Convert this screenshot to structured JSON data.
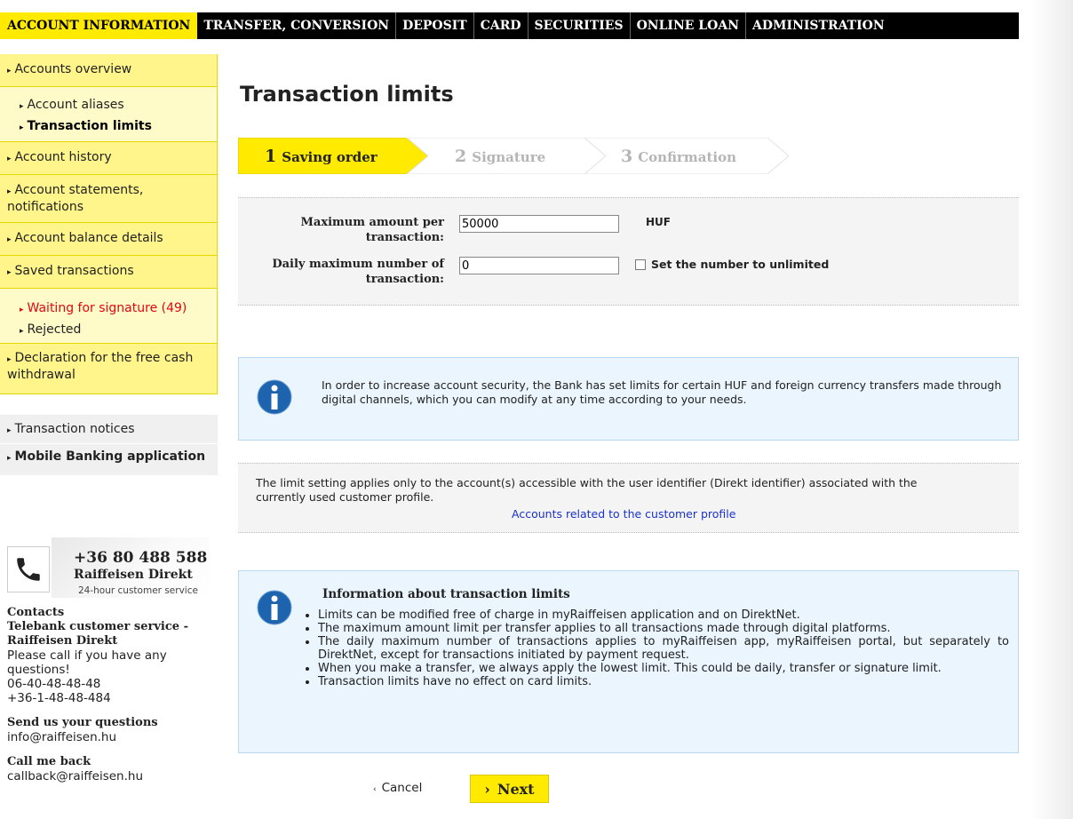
{
  "topnav": {
    "tabs": [
      {
        "label": "ACCOUNT INFORMATION"
      },
      {
        "label": "TRANSFER, CONVERSION"
      },
      {
        "label": "DEPOSIT"
      },
      {
        "label": "CARD"
      },
      {
        "label": "SECURITIES"
      },
      {
        "label": "ONLINE LOAN"
      },
      {
        "label": "ADMINISTRATION"
      }
    ]
  },
  "sidebar": {
    "accounts_overview": "Accounts overview",
    "account_aliases": "Account aliases",
    "transaction_limits": "Transaction limits",
    "account_history": "Account history",
    "account_statements": "Account statements, notifications",
    "account_balance": "Account balance details",
    "saved_transactions": "Saved transactions",
    "waiting_signature": "Waiting for signature (49)",
    "rejected": "Rejected",
    "declaration": "Declaration for the free cash withdrawal",
    "transaction_notices": "Transaction notices",
    "mobile_banking": "Mobile Banking application"
  },
  "phone": {
    "number": "+36 80 488 588",
    "brand": "Raiffeisen Direkt",
    "service": "24-hour customer service",
    "icon": "phone-handset-icon"
  },
  "contacts": {
    "heading": "Contacts",
    "telebank": "Telebank customer service - Raiffeisen Direkt",
    "please_call": "Please call if you have any questions!",
    "phone1": "06-40-48-48-48",
    "phone2": "+36-1-48-48-484",
    "questions_heading": "Send us your questions",
    "questions_email": "info@raiffeisen.hu",
    "callback_heading": "Call me back",
    "callback_email": "callback@raiffeisen.hu"
  },
  "main": {
    "title": "Transaction limits",
    "steps": [
      {
        "num": "1",
        "label": "Saving order",
        "active": true
      },
      {
        "num": "2",
        "label": "Signature",
        "active": false
      },
      {
        "num": "3",
        "label": "Confirmation",
        "active": false
      }
    ],
    "form": {
      "max_amount_label": "Maximum amount per transaction:",
      "max_amount_value": "50000",
      "currency": "HUF",
      "daily_max_label": "Daily maximum number of transaction:",
      "daily_max_value": "0",
      "unlimited_label": "Set the number to unlimited"
    },
    "info1": "In order to increase account security, the Bank has set limits for certain HUF and foreign currency transfers made through digital channels, which you can modify at any time according to your needs.",
    "limit_note": "The limit setting applies only to the account(s) accessible with the user identifier (Direkt identifier) associated with the currently used customer profile.",
    "limit_link": "Accounts related to the customer profile",
    "info2": {
      "heading": "Information about transaction limits",
      "items": [
        "Limits can be modified free of charge in myRaiffeisen application and on DirektNet.",
        "The maximum amount limit per transfer applies to all transactions made through digital platforms.",
        "The daily maximum number of transactions applies to myRaiffeisen app, myRaiffeisen portal, but separately to DirektNet, except for transactions initiated by payment request.",
        "When you make a transfer, we always apply the lowest limit. This could be daily, transfer or signature limit.",
        "Transaction limits have no effect on card limits."
      ]
    },
    "cancel_label": "Cancel",
    "next_label": "Next"
  },
  "colors": {
    "brand_yellow": "#ffea00",
    "sidebar_yellow": "#fff58a",
    "info_blue": "#1d63ad",
    "error_red": "#e30613",
    "link_blue": "#1a32c9"
  }
}
